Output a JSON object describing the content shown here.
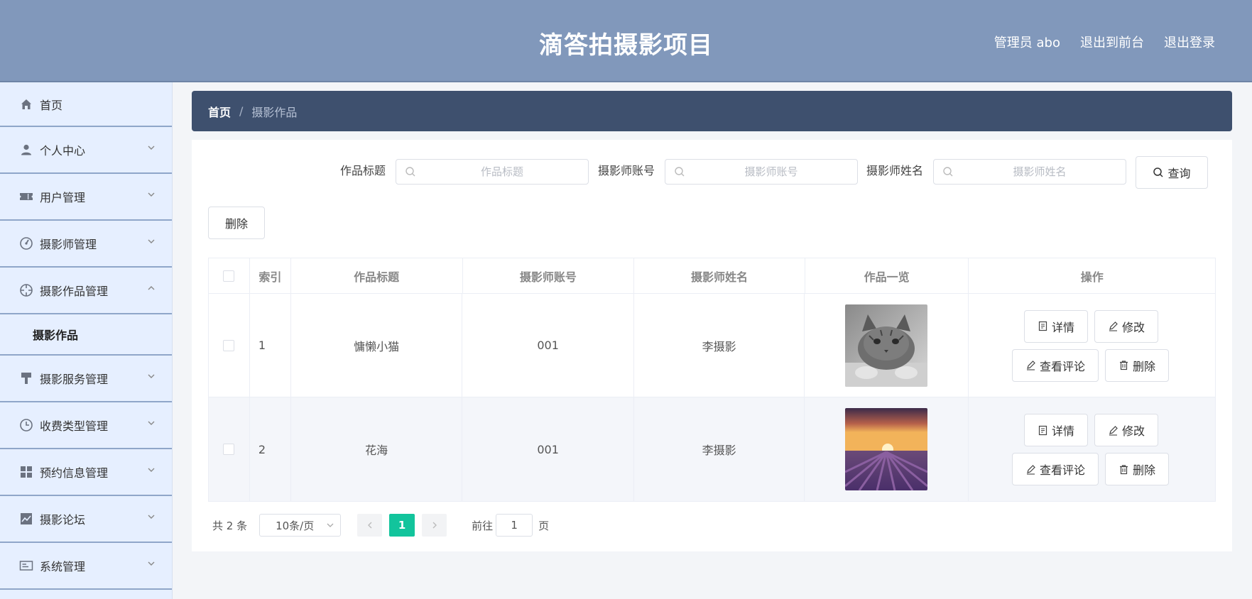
{
  "header": {
    "title": "滴答拍摄影项目",
    "user": "管理员 abo",
    "front": "退出到前台",
    "logout": "退出登录"
  },
  "sidebar": {
    "items": [
      {
        "label": "首页",
        "icon": "home-icon"
      },
      {
        "label": "个人中心",
        "icon": "user-icon"
      },
      {
        "label": "用户管理",
        "icon": "ticket-icon"
      },
      {
        "label": "摄影师管理",
        "icon": "gauge-icon"
      },
      {
        "label": "摄影作品管理",
        "icon": "crosshair-icon"
      },
      {
        "label": "摄影服务管理",
        "icon": "brush-icon"
      },
      {
        "label": "收费类型管理",
        "icon": "clock-icon"
      },
      {
        "label": "预约信息管理",
        "icon": "grid-icon"
      },
      {
        "label": "摄影论坛",
        "icon": "chart-icon"
      },
      {
        "label": "系统管理",
        "icon": "idcard-icon"
      }
    ],
    "submenu": "摄影作品"
  },
  "breadcrumb": {
    "home": "首页",
    "sep": "/",
    "current": "摄影作品"
  },
  "search": {
    "title_label": "作品标题",
    "title_placeholder": "作品标题",
    "account_label": "摄影师账号",
    "account_placeholder": "摄影师账号",
    "name_label": "摄影师姓名",
    "name_placeholder": "摄影师姓名",
    "query": "查询"
  },
  "toolbar": {
    "delete": "删除"
  },
  "table": {
    "headers": [
      "索引",
      "作品标题",
      "摄影师账号",
      "摄影师姓名",
      "作品一览",
      "操作"
    ],
    "rows": [
      {
        "index": "1",
        "title": "慵懒小猫",
        "account": "001",
        "name": "李摄影"
      },
      {
        "index": "2",
        "title": "花海",
        "account": "001",
        "name": "李摄影"
      }
    ],
    "ops": {
      "detail": "详情",
      "edit": "修改",
      "comments": "查看评论",
      "delete": "删除"
    }
  },
  "pager": {
    "total": "共 2 条",
    "size": "10条/页",
    "current": "1",
    "goto": "前往",
    "goto_value": "1",
    "page_unit": "页"
  },
  "colors": {
    "header": "#8198bb",
    "breadcrumb": "#3e506e",
    "sidebar": "#e6efff",
    "active_page": "#12c49c"
  }
}
